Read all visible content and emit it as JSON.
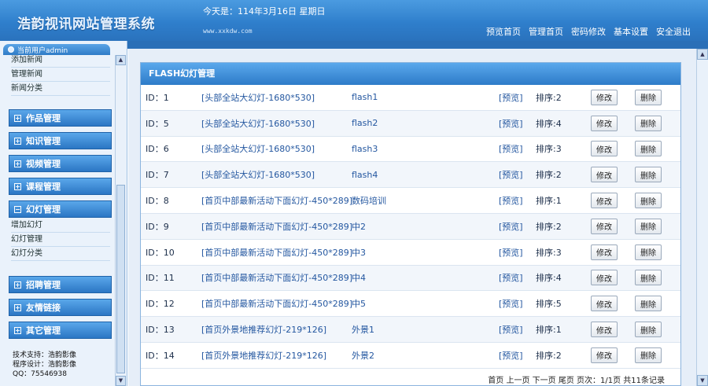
{
  "header": {
    "logo": "浩韵视讯网站管理系统",
    "date_label": "今天是：114年3月16日 星期日",
    "domain": "www.xxkdw.com",
    "nav": [
      "预览首页",
      "管理首页",
      "密码修改",
      "基本设置",
      "安全退出"
    ]
  },
  "sidebar": {
    "user_label": "当前用户admin",
    "news_items": [
      "添加新闻",
      "管理新闻",
      "新闻分类"
    ],
    "menus": [
      "作品管理",
      "知识管理",
      "视频管理",
      "课程管理",
      "幻灯管理"
    ],
    "slide_items": [
      "增加幻灯",
      "幻灯管理",
      "幻灯分类"
    ],
    "menus_bottom": [
      "招聘管理",
      "友情链接",
      "其它管理"
    ],
    "support": "技术支持：浩韵影像",
    "designer": "程序设计：浩韵影像",
    "qq": "QQ：75546938"
  },
  "panel": {
    "title": "FLASH幻灯管理",
    "preview_label": "[预览]",
    "edit_label": "修改",
    "delete_label": "删除",
    "rows": [
      {
        "id": "ID：1",
        "category": "[头部全站大幻灯-1680*530]",
        "name": "flash1",
        "sort": "排序:2"
      },
      {
        "id": "ID：5",
        "category": "[头部全站大幻灯-1680*530]",
        "name": "flash2",
        "sort": "排序:4"
      },
      {
        "id": "ID：6",
        "category": "[头部全站大幻灯-1680*530]",
        "name": "flash3",
        "sort": "排序:3"
      },
      {
        "id": "ID：7",
        "category": "[头部全站大幻灯-1680*530]",
        "name": "flash4",
        "sort": "排序:2"
      },
      {
        "id": "ID：8",
        "category": "[首页中部最新活动下面幻灯-450*289]",
        "name": "数码培训",
        "sort": "排序:1"
      },
      {
        "id": "ID：9",
        "category": "[首页中部最新活动下面幻灯-450*289]",
        "name": "中2",
        "sort": "排序:2"
      },
      {
        "id": "ID：10",
        "category": "[首页中部最新活动下面幻灯-450*289]",
        "name": "中3",
        "sort": "排序:3"
      },
      {
        "id": "ID：11",
        "category": "[首页中部最新活动下面幻灯-450*289]",
        "name": "中4",
        "sort": "排序:4"
      },
      {
        "id": "ID：12",
        "category": "[首页中部最新活动下面幻灯-450*289]",
        "name": "中5",
        "sort": "排序:5"
      },
      {
        "id": "ID：13",
        "category": "[首页外景地推荐幻灯-219*126]",
        "name": "外景1",
        "sort": "排序:1"
      },
      {
        "id": "ID：14",
        "category": "[首页外景地推荐幻灯-219*126]",
        "name": "外景2",
        "sort": "排序:2"
      }
    ],
    "pager": "首页 上一页 下一页 尾页 页次：1/1页 共11条记录"
  }
}
